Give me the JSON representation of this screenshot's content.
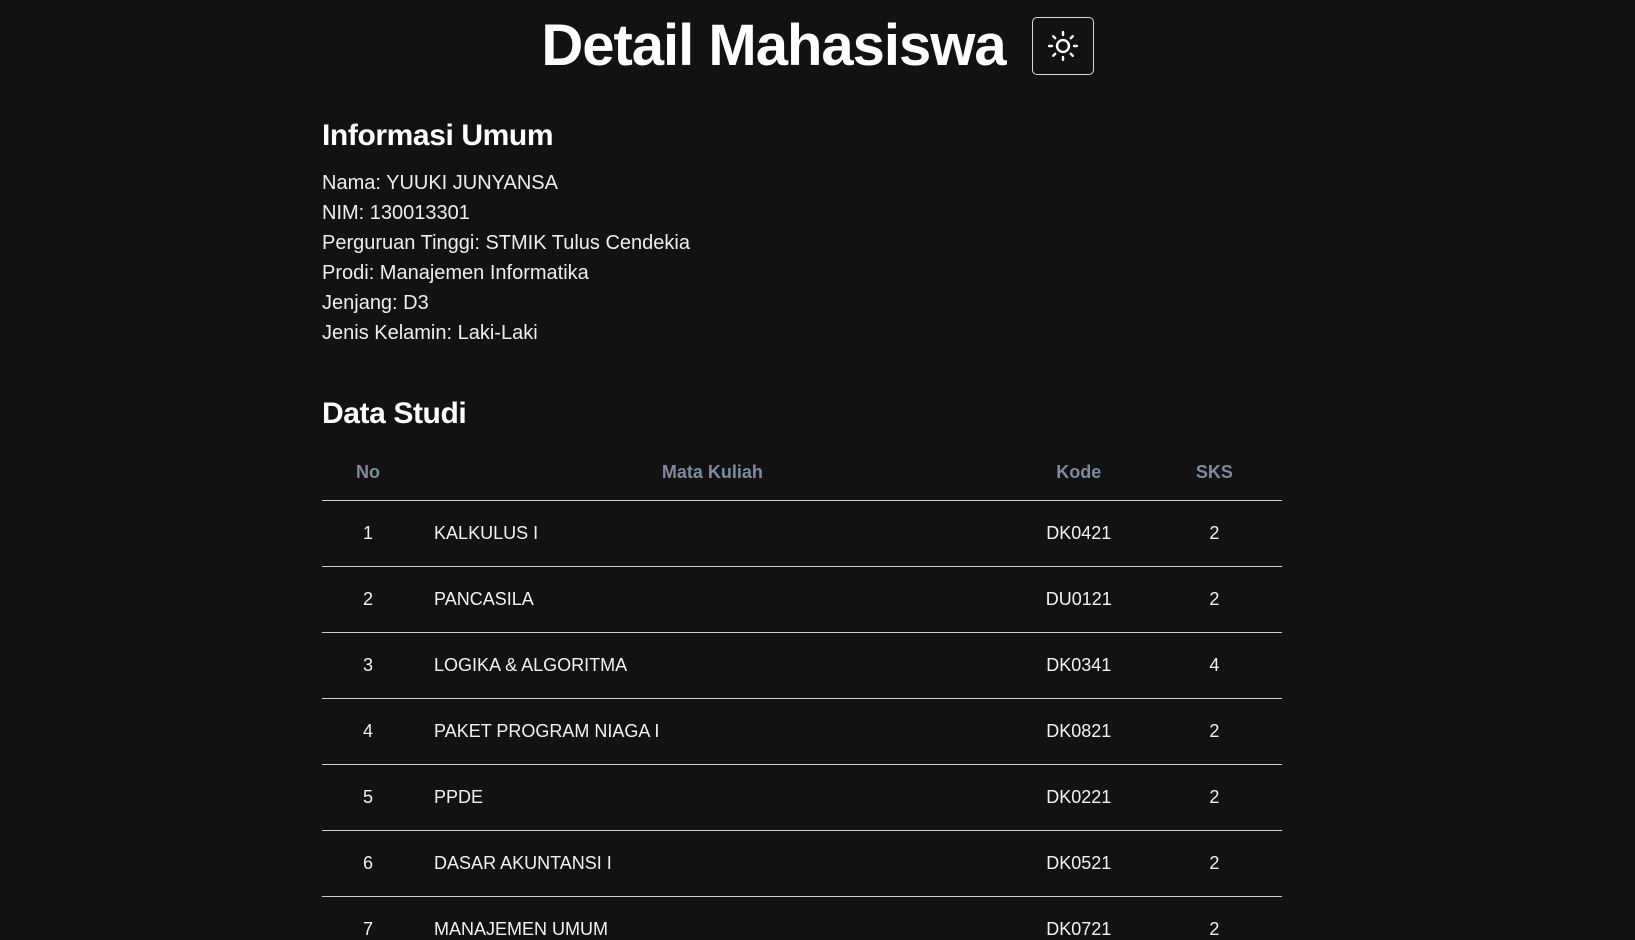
{
  "header": {
    "title": "Detail Mahasiswa",
    "theme_toggle_icon": "sun-icon"
  },
  "info": {
    "title": "Informasi Umum",
    "items": [
      "Nama: YUUKI JUNYANSA",
      "NIM: 130013301",
      "Perguruan Tinggi: STMIK Tulus Cendekia",
      "Prodi: Manajemen Informatika",
      "Jenjang: D3",
      "Jenis Kelamin: Laki-Laki"
    ]
  },
  "study": {
    "title": "Data Studi",
    "columns": [
      "No",
      "Mata Kuliah",
      "Kode",
      "SKS"
    ],
    "rows": [
      [
        "1",
        "KALKULUS I",
        "DK0421",
        "2"
      ],
      [
        "2",
        "PANCASILA",
        "DU0121",
        "2"
      ],
      [
        "3",
        "LOGIKA & ALGORITMA",
        "DK0341",
        "4"
      ],
      [
        "4",
        "PAKET PROGRAM NIAGA I",
        "DK0821",
        "2"
      ],
      [
        "5",
        "PPDE",
        "DK0221",
        "2"
      ],
      [
        "6",
        "DASAR AKUNTANSI I",
        "DK0521",
        "2"
      ],
      [
        "7",
        "MANAJEMEN UMUM",
        "DK0721",
        "2"
      ]
    ]
  },
  "colors": {
    "background": "#121212",
    "text": "#f2f2f2",
    "header_muted": "#7f8a9e",
    "divider": "#cfcfcf"
  }
}
